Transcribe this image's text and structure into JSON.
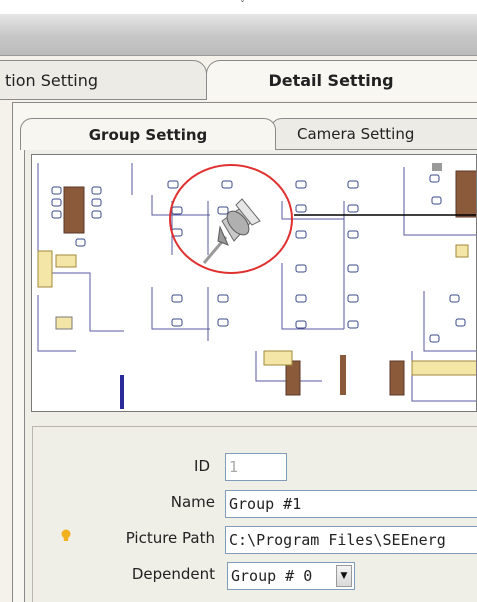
{
  "outer_tabs": [
    {
      "label": "tion Setting"
    },
    {
      "label": "Detail Setting"
    }
  ],
  "inner_tabs": [
    {
      "label": "Group Setting"
    },
    {
      "label": "Camera Setting"
    }
  ],
  "floor_plan": {
    "marker_icon": "pushpin-icon",
    "marker_highlight_color": "#e03030"
  },
  "form": {
    "id_label": "ID",
    "id_value": "1",
    "name_label": "Name",
    "name_value": "Group #1",
    "picture_path_label": "Picture Path",
    "picture_path_value": "C:\\Program Files\\SEEnerg",
    "picture_path_icon": "lightbulb-icon",
    "dependent_label": "Dependent",
    "dependent_value": "Group # 0"
  },
  "colors": {
    "accent_hint": "#f0b020",
    "tab_border": "#8a8a8a",
    "field_border": "#7f9db9"
  }
}
